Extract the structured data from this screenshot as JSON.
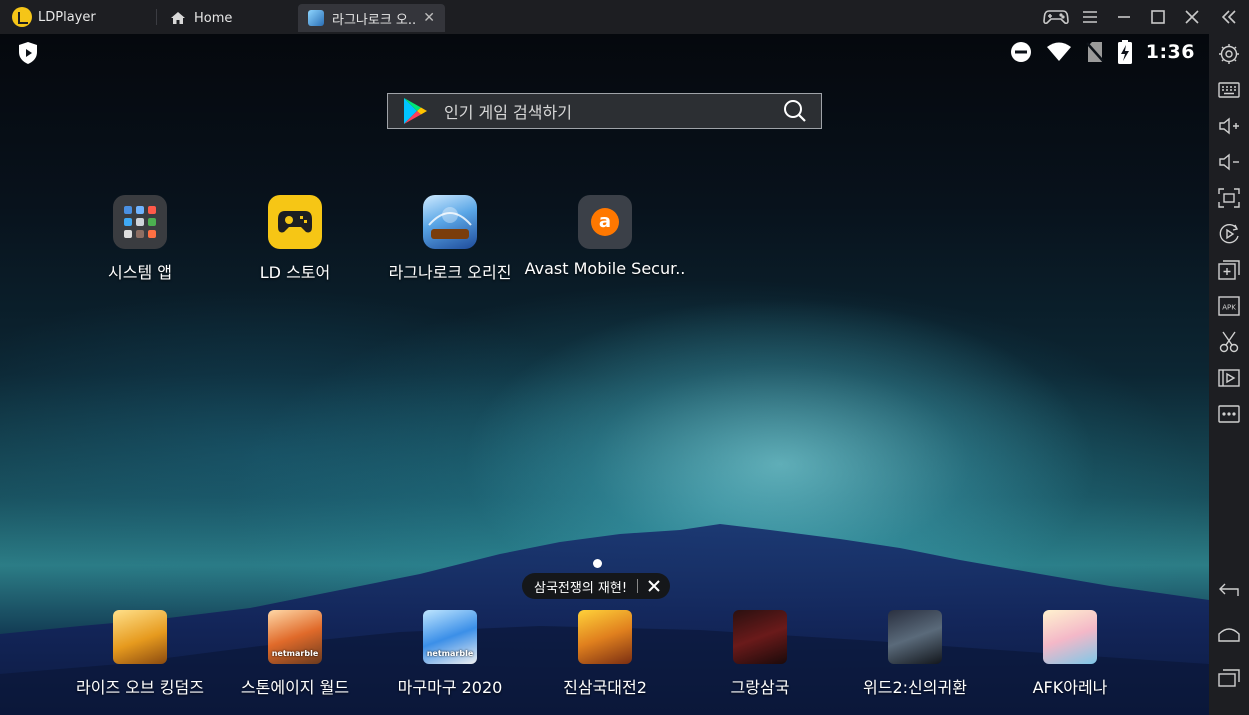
{
  "titlebar": {
    "app_name": "LDPlayer",
    "tabs": [
      {
        "label": "Home"
      },
      {
        "label": "라그나로크 오..."
      }
    ]
  },
  "statusbar": {
    "time": "1:36"
  },
  "search": {
    "placeholder": "인기 게임 검색하기"
  },
  "apps": [
    {
      "label": "시스템 앱"
    },
    {
      "label": "LD 스토어"
    },
    {
      "label": "라그나로크 오리진"
    },
    {
      "label": "Avast Mobile Secur.."
    }
  ],
  "promo": {
    "text": "삼국전쟁의 재현!"
  },
  "dock": [
    {
      "label": "라이즈 오브 킹덤즈",
      "badge": ""
    },
    {
      "label": "스톤에이지 월드",
      "badge": "netmarble"
    },
    {
      "label": "마구마구 2020",
      "badge": "netmarble"
    },
    {
      "label": "진삼국대전2",
      "badge": ""
    },
    {
      "label": "그랑삼국",
      "badge": ""
    },
    {
      "label": "위드2:신의귀환",
      "badge": ""
    },
    {
      "label": "AFK아레나",
      "badge": ""
    }
  ],
  "colors": {
    "accent": "#f6c615",
    "titlebar_bg": "#1d1e22",
    "avast_orange": "#ff7800"
  }
}
